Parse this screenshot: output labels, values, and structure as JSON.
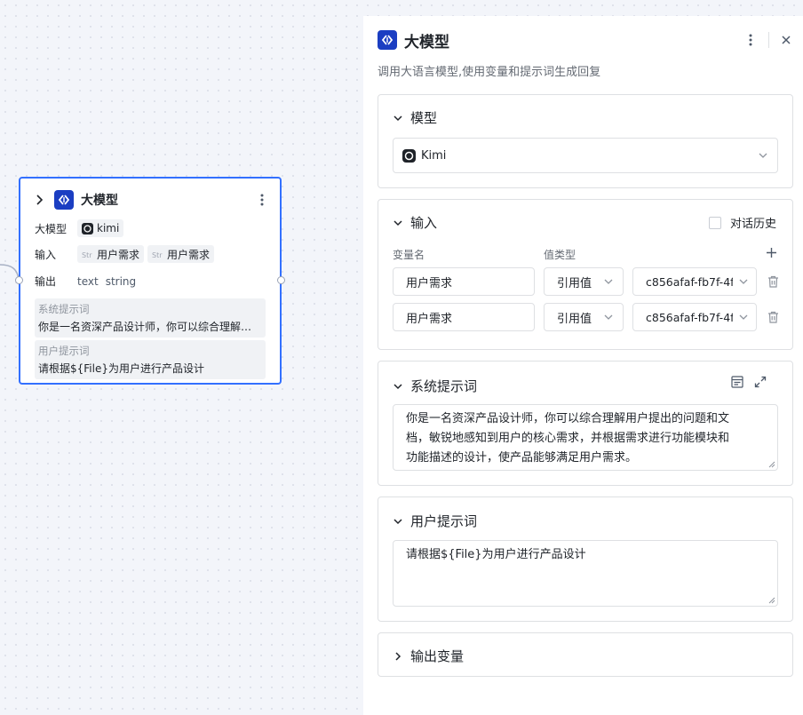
{
  "node": {
    "title": "大模型",
    "model_label": "大模型",
    "model_value": "kimi",
    "input_label": "输入",
    "inputs": [
      "用户需求",
      "用户需求"
    ],
    "output_label": "输出",
    "output_name": "text",
    "output_type": "string",
    "system_prompt_title": "系统提示词",
    "system_prompt_value": "你是一名资深产品设计师，你可以综合理解用户提出的问题和文档，敏锐地感知到用户的核心需求",
    "user_prompt_title": "用户提示词",
    "user_prompt_value": "请根据${File}为用户进行产品设计"
  },
  "panel": {
    "title": "大模型",
    "description": "调用大语言模型,使用变量和提示词生成回复",
    "model_section": {
      "title": "模型",
      "selected": "Kimi"
    },
    "input_section": {
      "title": "输入",
      "history_label": "对话历史",
      "col_name": "变量名",
      "col_type": "值类型",
      "rows": [
        {
          "name": "用户需求",
          "type": "引用值",
          "ref": "c856afaf-fb7f-4fl"
        },
        {
          "name": "用户需求",
          "type": "引用值",
          "ref": "c856afaf-fb7f-4fl"
        }
      ]
    },
    "system_section": {
      "title": "系统提示词",
      "lines": [
        "你是一名资深产品设计师，你可以综合理解用户提出的问题和文",
        "档，敏锐地感知到用户的核心需求，并根据需求进行功能模块和",
        "功能描述的设计，使产品能够满足用户需求。"
      ]
    },
    "user_section": {
      "title": "用户提示词",
      "value": "请根据${File}为用户进行产品设计"
    },
    "output_section": {
      "title": "输出变量"
    }
  },
  "colors": {
    "accent": "#3370ff",
    "app_icon": "#1b3ec2",
    "border": "#dee0e3"
  }
}
